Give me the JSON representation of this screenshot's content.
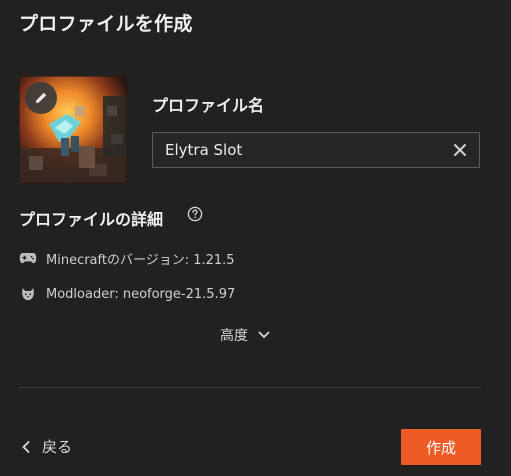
{
  "dialog": {
    "title": "プロファイルを作成"
  },
  "profile": {
    "name_label": "プロファイル名",
    "name_value": "Elytra Slot",
    "thumbnail_icon": "edit-pencil-icon"
  },
  "details": {
    "heading": "プロファイルの詳細",
    "help_icon": "question-circle-icon",
    "version_label": "Minecraftのバージョン: 1.21.5",
    "version_icon": "gamepad-icon",
    "loader_label": "Modloader: neoforge-21.5.97",
    "loader_icon": "neoforge-fox-icon"
  },
  "advanced": {
    "label": "高度",
    "icon": "chevron-down-icon"
  },
  "footer": {
    "back_label": "戻る",
    "back_icon": "chevron-left-icon",
    "create_label": "作成"
  },
  "colors": {
    "background": "#212121",
    "accent": "#ef5b25",
    "divider": "#3a3a3a"
  }
}
